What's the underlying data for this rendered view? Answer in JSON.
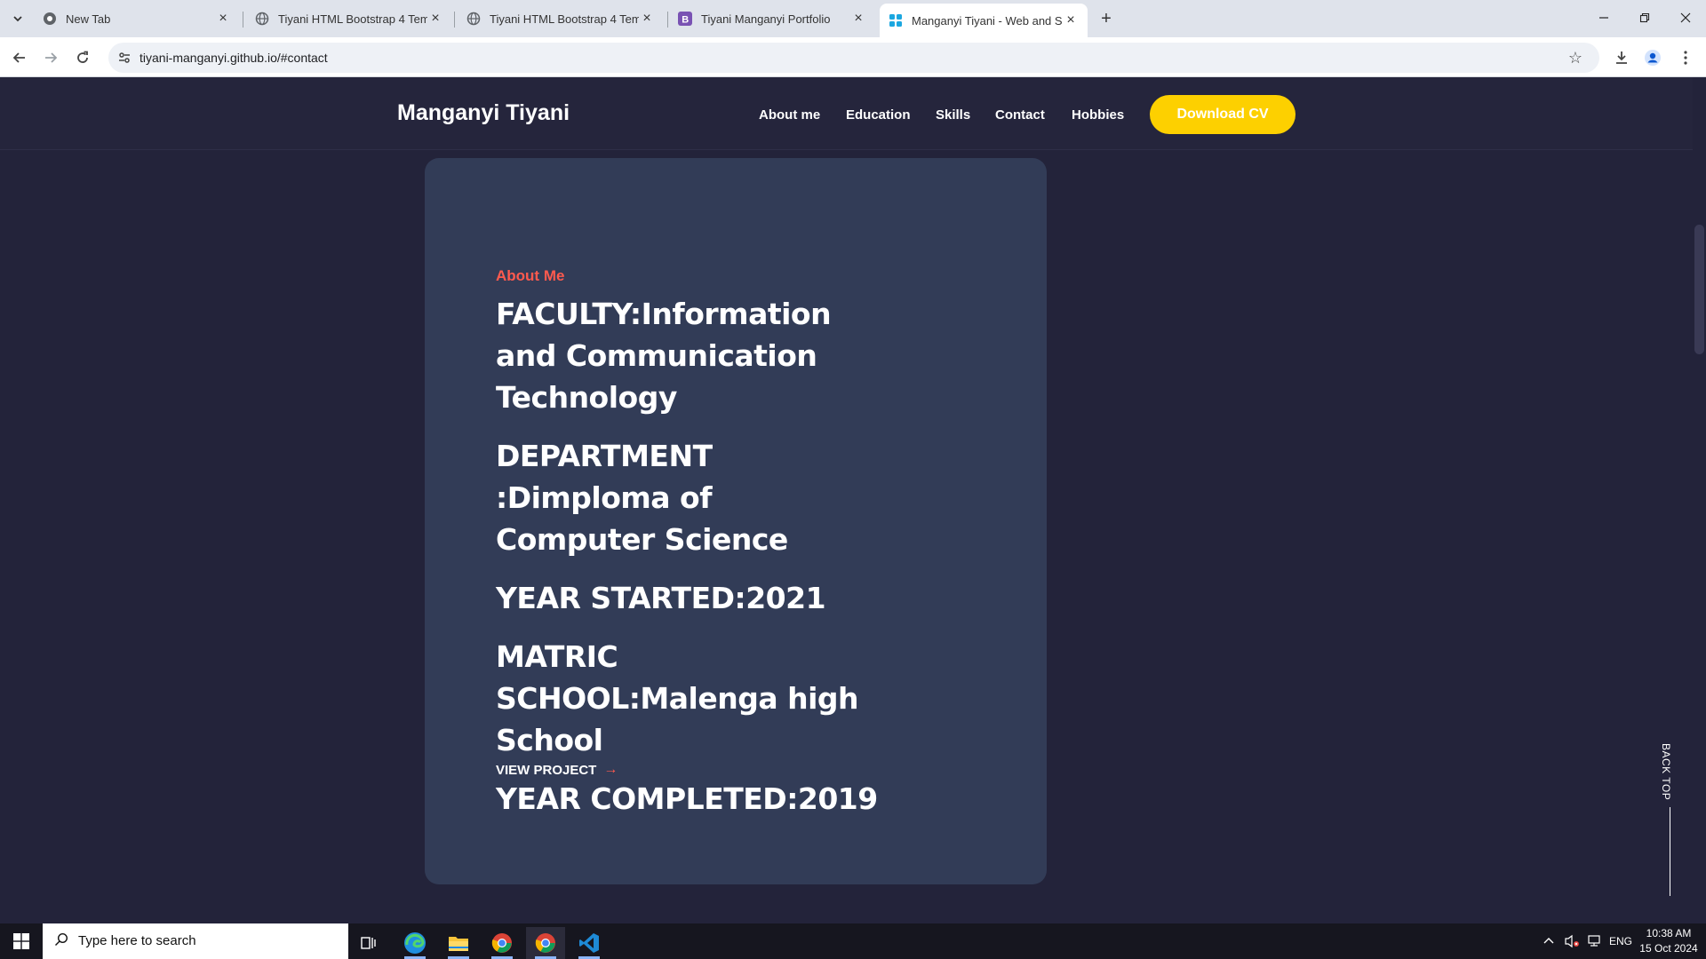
{
  "browser": {
    "tabs": [
      {
        "title": "New Tab",
        "favicon": "chrome-icon",
        "active": false
      },
      {
        "title": "Tiyani HTML Bootstrap 4 Templ",
        "favicon": "globe-icon",
        "active": false
      },
      {
        "title": "Tiyani HTML Bootstrap 4 Templ",
        "favicon": "globe-icon",
        "active": false
      },
      {
        "title": "Tiyani Manganyi Portfolio",
        "favicon": "bootstrap-icon",
        "active": false
      },
      {
        "title": "Manganyi Tiyani - Web and Sof",
        "favicon": "site-icon",
        "active": true
      }
    ],
    "url": "tiyani-manganyi.github.io/#contact"
  },
  "site": {
    "brand": "Manganyi Tiyani",
    "nav": [
      "About me",
      "Education",
      "Skills",
      "Contact",
      "Hobbies"
    ],
    "cta": "Download CV",
    "colors": {
      "accent": "#fdd000",
      "eyebrow": "#ff5a4e",
      "card": "#323c57",
      "background": "#23233a"
    }
  },
  "card": {
    "eyebrow": "About Me",
    "facts": [
      "FACULTY:Information and Communication Technology",
      "DEPARTMENT :Dimploma of Computer Science",
      "YEAR STARTED:2021",
      "MATRIC SCHOOL:Malenga high School",
      "YEAR COMPLETED:2019"
    ],
    "link": "VIEW PROJECT"
  },
  "back_top": "BACK TOP",
  "taskbar": {
    "search_placeholder": "Type here to search",
    "lang": "ENG",
    "time": "10:38 AM",
    "date": "15 Oct 2024"
  }
}
